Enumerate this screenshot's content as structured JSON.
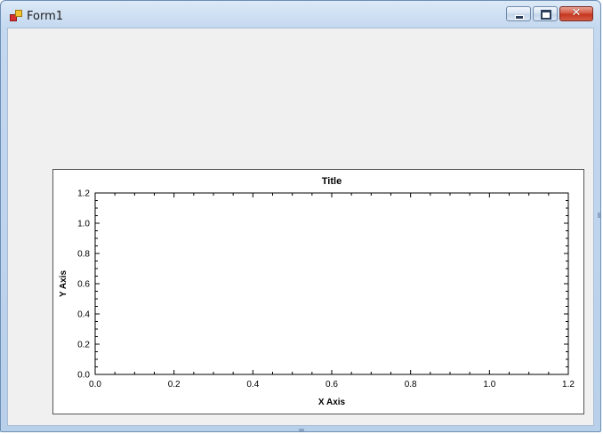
{
  "window": {
    "title": "Form1",
    "close_glyph": "✕"
  },
  "icons": {
    "app": "app-form-icon",
    "minimize": "minimize-icon",
    "maximize": "maximize-icon",
    "close": "close-icon"
  },
  "chart_data": {
    "type": "line",
    "title": "Title",
    "xlabel": "X Axis",
    "ylabel": "Y Axis",
    "xlim": [
      0,
      1.2
    ],
    "ylim": [
      0,
      1.2
    ],
    "x_ticks": [
      0.0,
      0.2,
      0.4,
      0.6,
      0.8,
      1.0,
      1.2
    ],
    "y_ticks": [
      0.0,
      0.2,
      0.4,
      0.6,
      0.8,
      1.0,
      1.2
    ],
    "x_tick_labels": [
      "0.0",
      "0.2",
      "0.4",
      "0.6",
      "0.8",
      "1.0",
      "1.2"
    ],
    "y_tick_labels": [
      "0.0",
      "0.2",
      "0.4",
      "0.6",
      "0.8",
      "1.0",
      "1.2"
    ],
    "minor_per_major": 4,
    "grid": false,
    "series": []
  }
}
